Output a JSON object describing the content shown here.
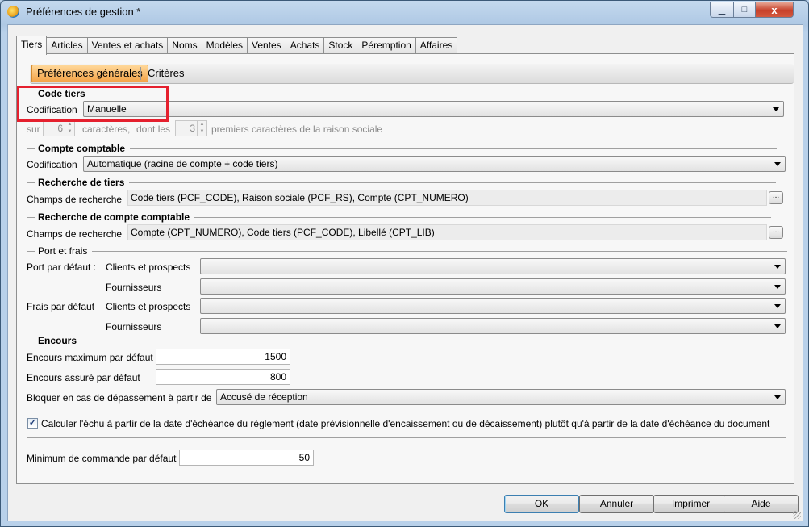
{
  "window": {
    "title": "Préférences de gestion *",
    "min_label": "▁",
    "max_label": "□",
    "close_label": "x"
  },
  "tabs": [
    {
      "label": "Tiers",
      "active": true
    },
    {
      "label": "Articles"
    },
    {
      "label": "Ventes et achats"
    },
    {
      "label": "Noms"
    },
    {
      "label": "Modèles"
    },
    {
      "label": "Ventes"
    },
    {
      "label": "Achats"
    },
    {
      "label": "Stock"
    },
    {
      "label": "Péremption"
    },
    {
      "label": "Affaires"
    }
  ],
  "subtabs": {
    "active": "Préférences générales",
    "other": "Critères"
  },
  "code_tiers": {
    "header": "Code tiers",
    "codification_label": "Codification",
    "codification_value": "Manuelle",
    "sur_label": "sur",
    "sur_value": "6",
    "caracteres_label": "caractères,",
    "dont_les_label": "dont les",
    "dont_les_value": "3",
    "premiers_label": "premiers caractères de la raison sociale"
  },
  "compte_comptable": {
    "header": "Compte comptable",
    "codification_label": "Codification",
    "codification_value": "Automatique (racine de compte + code tiers)"
  },
  "recherche_tiers": {
    "header": "Recherche de tiers",
    "champs_label": "Champs de recherche",
    "champs_value": "Code tiers (PCF_CODE), Raison sociale (PCF_RS), Compte (CPT_NUMERO)",
    "browse_label": "..."
  },
  "recherche_compte": {
    "header": "Recherche de compte comptable",
    "champs_label": "Champs de recherche",
    "champs_value": "Compte (CPT_NUMERO), Code tiers (PCF_CODE), Libellé (CPT_LIB)",
    "browse_label": "..."
  },
  "port_frais": {
    "header": "Port et frais",
    "port_label": "Port par défaut :",
    "frais_label": "Frais par défaut",
    "clients_label": "Clients et prospects",
    "fournisseurs_label": "Fournisseurs",
    "port_clients_value": "",
    "port_fournisseurs_value": "",
    "frais_clients_value": "",
    "frais_fournisseurs_value": ""
  },
  "encours": {
    "header": "Encours",
    "max_label": "Encours maximum par défaut",
    "max_value": "1500",
    "assure_label": "Encours assuré par défaut",
    "assure_value": "800",
    "bloquer_label": "Bloquer en cas de dépassement à partir de",
    "bloquer_value": "Accusé de réception"
  },
  "echu": {
    "checked": true,
    "check_mark": "✓",
    "label": "Calculer l'échu à partir de la date d'échéance du règlement (date prévisionnelle d'encaissement ou de décaissement) plutôt qu'à partir de la date d'échéance du document"
  },
  "minimum": {
    "label": "Minimum de commande par défaut",
    "value": "50"
  },
  "buttons": {
    "ok": "OK",
    "annuler": "Annuler",
    "imprimer": "Imprimer",
    "aide": "Aide"
  },
  "colors": {
    "highlight": "#e5202e",
    "active_subtab": "#f4a449",
    "title_bar": "#b9d1ea"
  }
}
